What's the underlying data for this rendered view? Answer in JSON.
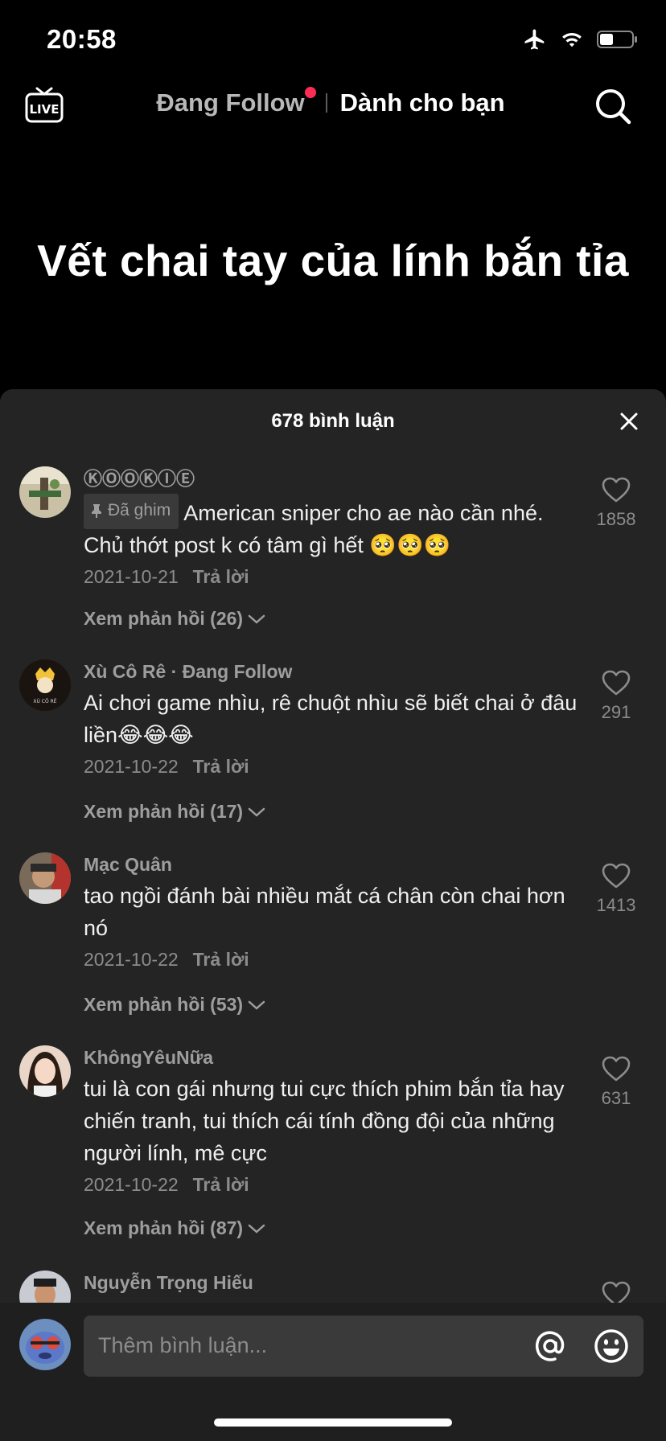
{
  "status_bar": {
    "time": "20:58"
  },
  "top_nav": {
    "tab_following": "Đang Follow",
    "tab_for_you": "Dành cho bạn"
  },
  "video": {
    "caption": "Vết chai tay của lính bắn tỉa"
  },
  "comments_sheet": {
    "title": "678 bình luận",
    "comments": [
      {
        "username": "ⓀⓄⓄⓀⒾⒺ",
        "pinned_label": "Đã ghim",
        "text": "American sniper cho ae nào cần nhé. Chủ thớt post k có tâm gì hết 🥺🥺🥺",
        "date": "2021-10-21",
        "reply_label": "Trả lời",
        "view_replies": "Xem phản hồi (26)",
        "likes": "1858"
      },
      {
        "username": "Xù Cô Rê",
        "follow_tag": "· Đang Follow",
        "text": "Ai chơi game nhìu, rê chuột nhìu sẽ biết chai ở đâu liền😂😂😂",
        "date": "2021-10-22",
        "reply_label": "Trả lời",
        "view_replies": "Xem phản hồi (17)",
        "likes": "291"
      },
      {
        "username": "Mạc Quân",
        "text": "tao ngồi đánh bài nhiều mắt cá chân còn chai hơn nó",
        "date": "2021-10-22",
        "reply_label": "Trả lời",
        "view_replies": "Xem phản hồi (53)",
        "likes": "1413"
      },
      {
        "username": "KhôngYêuNữa",
        "text": "tui là con gái nhưng tui cực thích phim bắn tỉa hay chiến tranh, tui thích cái tính đồng đội của những người lính, mê cực",
        "date": "2021-10-22",
        "reply_label": "Trả lời",
        "view_replies": "Xem phản hồi (87)",
        "likes": "631"
      },
      {
        "username": "Nguyễn Trọng Hiếu"
      }
    ]
  },
  "input_bar": {
    "placeholder": "Thêm bình luận..."
  },
  "colors": {
    "accent": "#fe2c55",
    "sheet_bg": "#242424",
    "muted_text": "#9e9e9e"
  },
  "icons": [
    "live-icon",
    "search-icon",
    "close-icon",
    "heart-icon",
    "pin-icon",
    "chevron-down-icon",
    "at-icon",
    "emoji-icon",
    "airplane-icon",
    "wifi-icon",
    "battery-icon"
  ]
}
